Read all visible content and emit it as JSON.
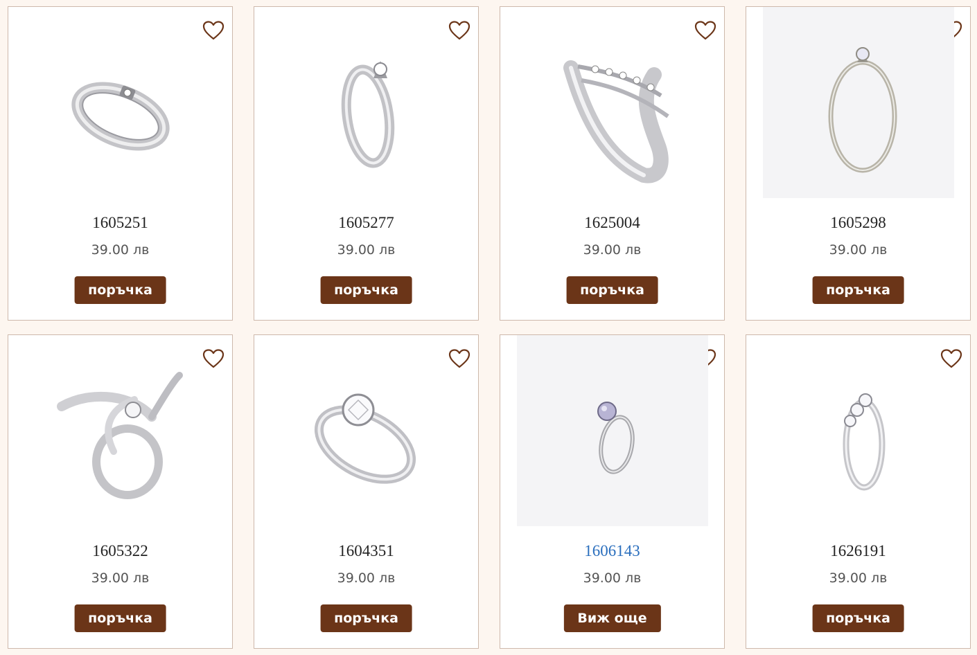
{
  "colors": {
    "page_background": "#fdf6f0",
    "card_border": "#cdb8ab",
    "button_background": "#6b3518",
    "heart_outline": "#6b3518",
    "link_code": "#2a6ebd"
  },
  "products": [
    {
      "code": "1605251",
      "price": "39.00 лв",
      "button": "поръчка",
      "favorite_icon": "heart-outline-icon",
      "image": "ring-band-single-stone"
    },
    {
      "code": "1605277",
      "price": "39.00 лв",
      "button": "поръчка",
      "favorite_icon": "heart-outline-icon",
      "image": "ring-solitaire-twist"
    },
    {
      "code": "1625004",
      "price": "39.00 лв",
      "button": "поръчка",
      "favorite_icon": "heart-outline-icon",
      "image": "ring-wave-multi-stone"
    },
    {
      "code": "1605298",
      "price": "39.00 лв",
      "button": "поръчка",
      "favorite_icon": "heart-outline-icon",
      "image": "ring-thin-solitaire"
    },
    {
      "code": "1605322",
      "price": "39.00 лв",
      "button": "поръчка",
      "favorite_icon": "heart-outline-icon",
      "image": "ring-leaf-bypass"
    },
    {
      "code": "1604351",
      "price": "39.00 лв",
      "button": "поръчка",
      "favorite_icon": "heart-outline-icon",
      "image": "ring-large-solitaire"
    },
    {
      "code": "1606143",
      "price": "39.00 лв",
      "button": "Виж още",
      "favorite_icon": "heart-outline-icon",
      "image": "ring-lavender-stone"
    },
    {
      "code": "1626191",
      "price": "39.00 лв",
      "button": "поръчка",
      "favorite_icon": "heart-outline-icon",
      "image": "ring-three-stone"
    }
  ]
}
